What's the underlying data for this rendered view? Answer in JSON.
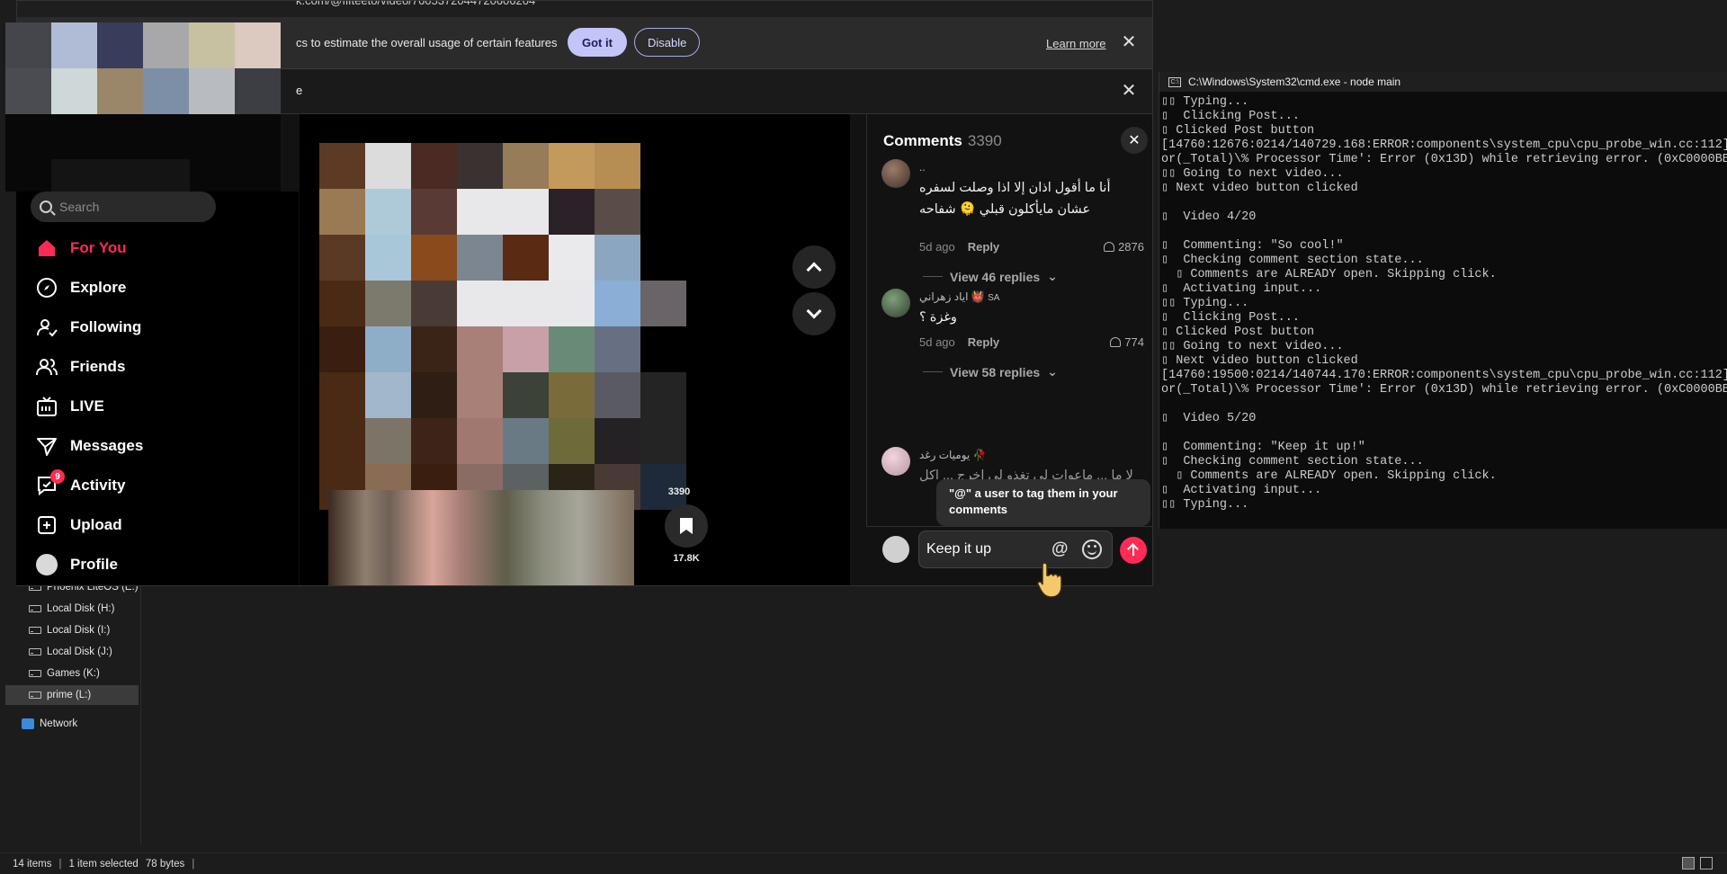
{
  "explorer": {
    "nav_items": [
      {
        "label": "Phoenix LiteOS (E:)",
        "selected": false
      },
      {
        "label": "Local Disk (H:)",
        "selected": false
      },
      {
        "label": "Local Disk (I:)",
        "selected": false
      },
      {
        "label": "Local Disk (J:)",
        "selected": false
      },
      {
        "label": "Games (K:)",
        "selected": false
      },
      {
        "label": "prime (L:)",
        "selected": true
      }
    ],
    "network_label": "Network",
    "status": {
      "items": "14 items",
      "selected": "1 item selected",
      "size": "78 bytes"
    }
  },
  "cmd": {
    "title": "C:\\Windows\\System32\\cmd.exe - node  main",
    "icon_label": "C:\\",
    "lines": [
      "▯▯ Typing...",
      "▯  Clicking Post...",
      "▯ Clicked Post button",
      "[14760:12676:0214/140729.168:ERROR:components\\system_cpu\\cpu_probe_win.cc:112] Err",
      "or(_Total)\\% Processor Time': Error (0x13D) while retrieving error. (0xC0000BB8)",
      "▯▯ Going to next video...",
      "▯ Next video button clicked",
      "",
      "▯  Video 4/20",
      "",
      "▯  Commenting: \"So cool!\"",
      "▯  Checking comment section state...",
      "  ▯ Comments are ALREADY open. Skipping click.",
      "▯  Activating input...",
      "▯▯ Typing...",
      "▯  Clicking Post...",
      "▯ Clicked Post button",
      "▯▯ Going to next video...",
      "▯ Next video button clicked",
      "[14760:19500:0214/140744.170:ERROR:components\\system_cpu\\cpu_probe_win.cc:112] Err",
      "or(_Total)\\% Processor Time': Error (0x13D) while retrieving error. (0xC0000BB8)",
      "",
      "▯  Video 5/20",
      "",
      "▯  Commenting: \"Keep it up!\"",
      "▯  Checking comment section state...",
      "  ▯ Comments are ALREADY open. Skipping click.",
      "▯  Activating input...",
      "▯▯ Typing..."
    ]
  },
  "browser": {
    "address": "k.com/@fifteeto/video/7605372044720606204",
    "notice_text": "cs to estimate the overall usage of certain features",
    "got_it": "Got it",
    "disable": "Disable",
    "learn_more": "Learn more",
    "second_bar_text": "e"
  },
  "sidebar": {
    "search_placeholder": "Search",
    "items": [
      {
        "label": "For You",
        "icon": "home-icon",
        "active": true
      },
      {
        "label": "Explore",
        "icon": "compass-icon",
        "active": false
      },
      {
        "label": "Following",
        "icon": "following-icon",
        "active": false
      },
      {
        "label": "Friends",
        "icon": "friends-icon",
        "active": false
      },
      {
        "label": "LIVE",
        "icon": "live-icon",
        "active": false
      },
      {
        "label": "Messages",
        "icon": "messages-icon",
        "active": false
      },
      {
        "label": "Activity",
        "icon": "activity-icon",
        "active": false,
        "badge": "9"
      },
      {
        "label": "Upload",
        "icon": "upload-icon",
        "active": false
      },
      {
        "label": "Profile",
        "icon": "profile-avatar",
        "active": false
      }
    ]
  },
  "video": {
    "share_count_partial": "3390",
    "save_count": "17.8K"
  },
  "comments": {
    "title": "Comments",
    "count": "3390",
    "list": [
      {
        "user": "..",
        "text": "أنا ما أقول اذان إلا اذا وصلت لسفره عشان مايأكلون قبلي 🫠 شفاحه",
        "age": "5d ago",
        "reply": "Reply",
        "likes": "2876",
        "view_replies": "View 46 replies"
      },
      {
        "user": "اياد زهراني 👹",
        "user_suffix": "SA",
        "text": "وغزة ؟",
        "age": "5d ago",
        "reply": "Reply",
        "likes": "774",
        "view_replies": "View 58 replies"
      },
      {
        "user": "يوميات رغد 🥀",
        "text": "لا ما ... ماعوات لي تغذو لي اخرج ... اكل"
      }
    ],
    "tooltip": "\"@\" a user to tag them in your comments",
    "input_value": "Keep it up",
    "at_symbol": "@"
  },
  "colors": {
    "accent": "#fe2c55",
    "got_it_bg": "#c3c4f7"
  }
}
